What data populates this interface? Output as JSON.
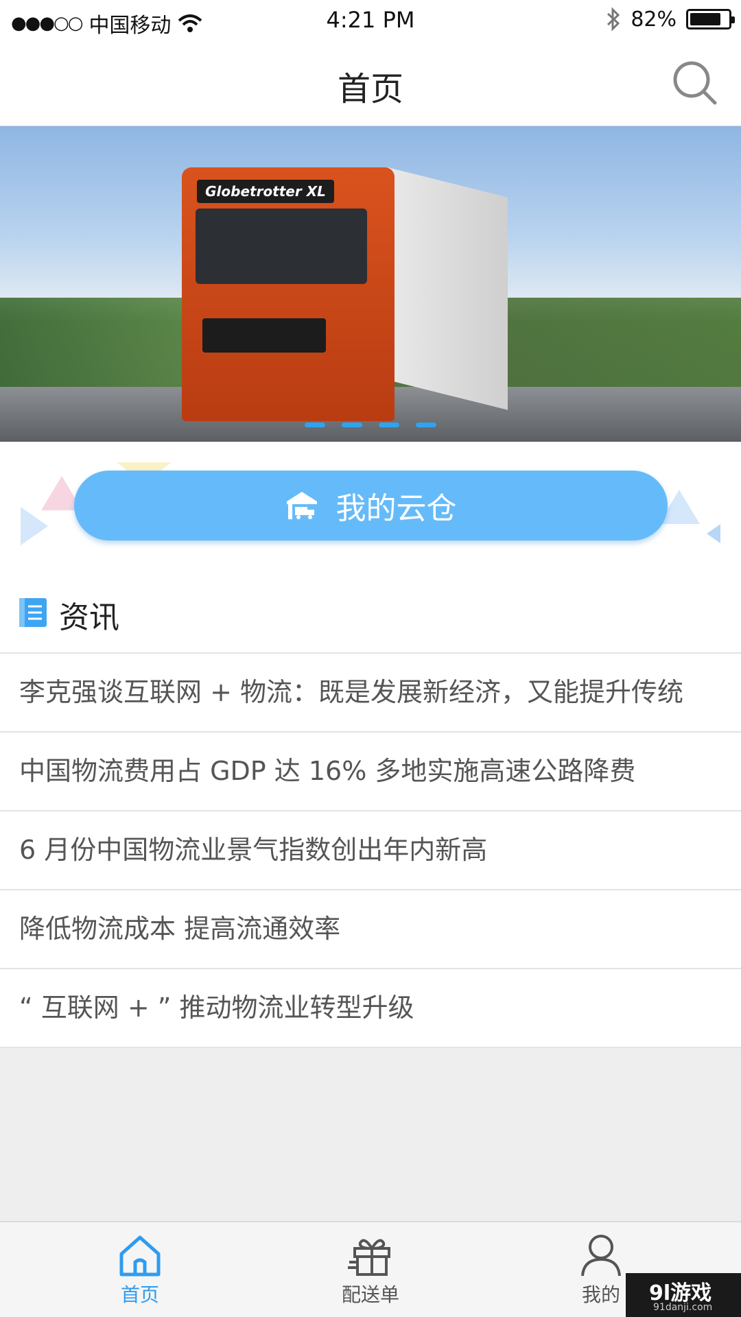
{
  "status_bar": {
    "signal": "●●●○○",
    "carrier": "中国移动",
    "time": "4:21 PM",
    "battery_text": "82%",
    "battery_level": 0.82
  },
  "nav": {
    "title": "首页",
    "search_icon": "search-icon"
  },
  "banner": {
    "truck_label": "Globetrotter XL",
    "slides": 4,
    "active_slide": 1
  },
  "cloud_button": {
    "label": "我的云仓",
    "icon": "warehouse-truck-icon"
  },
  "news": {
    "section_title": "资讯",
    "items": [
      "李克强谈互联网 + 物流：既是发展新经济，又能提升传统",
      "中国物流费用占 GDP 达 16% 多地实施高速公路降费",
      "6 月份中国物流业景气指数创出年内新高",
      "降低物流成本 提高流通效率",
      "“ 互联网 + ” 推动物流业转型升级"
    ]
  },
  "tabs": [
    {
      "label": "首页",
      "icon": "home-icon",
      "active": true
    },
    {
      "label": "配送单",
      "icon": "gift-icon",
      "active": false
    },
    {
      "label": "我的",
      "icon": "user-icon",
      "active": false
    }
  ],
  "colors": {
    "accent": "#2e9cf0",
    "cloud_button": "#65bbfa"
  },
  "watermark": {
    "main": "9l游戏",
    "sub": "91danji.com"
  }
}
